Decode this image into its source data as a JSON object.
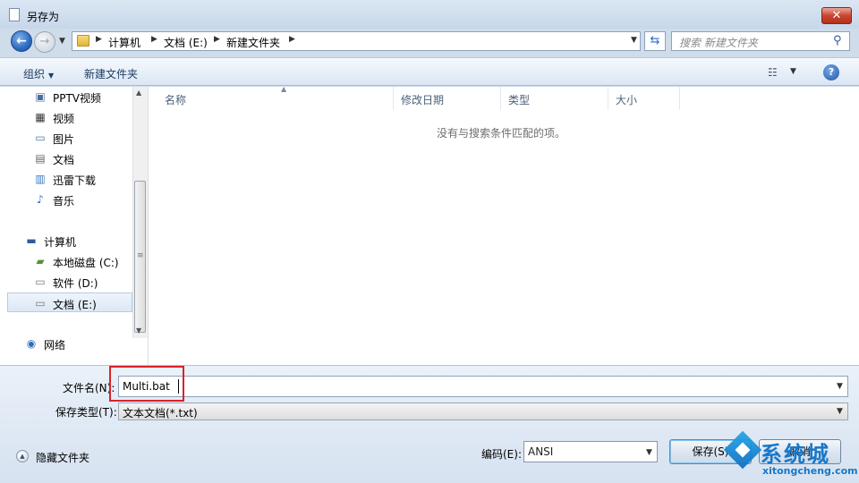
{
  "window": {
    "title": "另存为",
    "close_label": "✕"
  },
  "nav": {
    "breadcrumb": [
      "计算机",
      "文档 (E:)",
      "新建文件夹"
    ],
    "search_placeholder": "搜索 新建文件夹"
  },
  "toolbar": {
    "organize": "组织",
    "new_folder": "新建文件夹",
    "help": "?"
  },
  "sidebar": {
    "items": [
      {
        "label": "PPTV视频",
        "icon": "video-library-icon"
      },
      {
        "label": "视频",
        "icon": "film-icon"
      },
      {
        "label": "图片",
        "icon": "picture-icon"
      },
      {
        "label": "文档",
        "icon": "document-icon"
      },
      {
        "label": "迅雷下载",
        "icon": "download-folder-icon"
      },
      {
        "label": "音乐",
        "icon": "music-note-icon"
      },
      {
        "label": "计算机",
        "icon": "computer-icon"
      },
      {
        "label": "本地磁盘 (C:)",
        "icon": "system-drive-icon"
      },
      {
        "label": "软件 (D:)",
        "icon": "drive-icon"
      },
      {
        "label": "文档 (E:)",
        "icon": "drive-icon",
        "selected": true
      },
      {
        "label": "网络",
        "icon": "network-icon"
      }
    ]
  },
  "filelist": {
    "columns": [
      "名称",
      "修改日期",
      "类型",
      "大小"
    ],
    "empty_message": "没有与搜索条件匹配的项。"
  },
  "form": {
    "filename_label": "文件名(N):",
    "filename_value": "Multi.bat",
    "filetype_label": "保存类型(T):",
    "filetype_value": "文本文档(*.txt)",
    "hide_folders": "隐藏文件夹",
    "encoding_label": "编码(E):",
    "encoding_value": "ANSI",
    "save": "保存(S)",
    "cancel": "取消"
  },
  "watermark": {
    "brand": "系统城",
    "url": "xitongcheng.com"
  },
  "colors": {
    "highlight": "#d8232a",
    "accent": "#1878c8",
    "close": "#c9452f"
  }
}
